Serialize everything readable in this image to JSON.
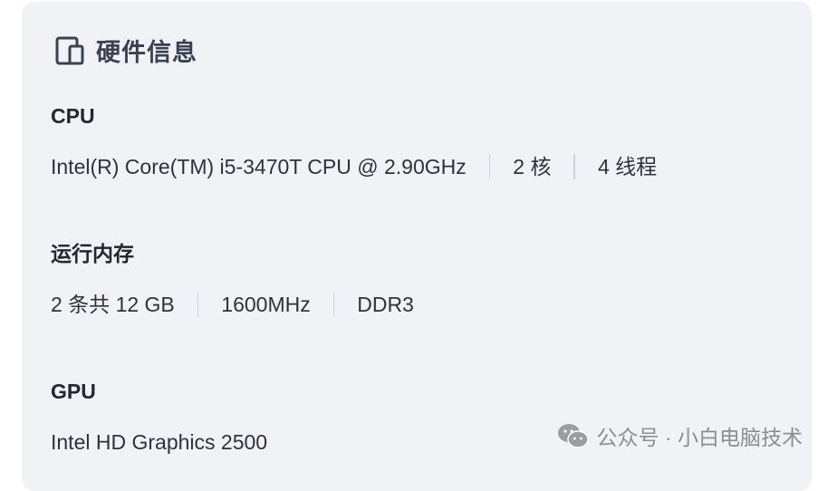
{
  "card": {
    "title": "硬件信息",
    "icon": "devices-icon"
  },
  "sections": [
    {
      "title": "CPU",
      "items": [
        "Intel(R) Core(TM) i5-3470T CPU @ 2.90GHz",
        "2 核",
        "4 线程"
      ]
    },
    {
      "title": "运行内存",
      "items": [
        "2 条共 12 GB",
        "1600MHz",
        "DDR3"
      ]
    },
    {
      "title": "GPU",
      "items": [
        "Intel HD Graphics 2500"
      ]
    }
  ],
  "watermark": {
    "text": "公众号 · 小白电脑技术",
    "icon": "wechat-icon"
  },
  "colors": {
    "card_background": "#f1f2f6",
    "title": "#3a4151",
    "text": "#2e323b",
    "separator": "#cfd2d8",
    "watermark": "#8b8e93"
  }
}
